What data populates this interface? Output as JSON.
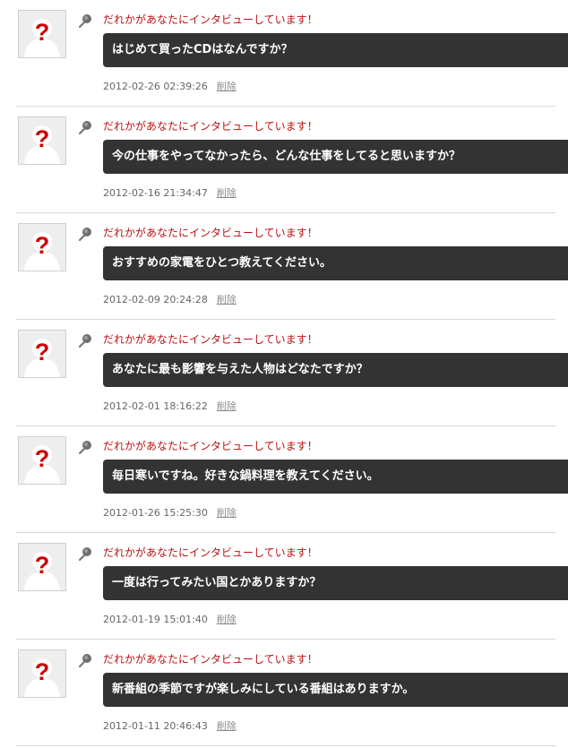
{
  "items": [
    {
      "heading": "だれかがあなたにインタビューしています！",
      "question": "はじめて買ったCDはなんですか？",
      "date": "2012-02-26 02:39:26",
      "delete_label": "削除"
    },
    {
      "heading": "だれかがあなたにインタビューしています！",
      "question": "今の仕事をやってなかったら、どんな仕事をしてると思いますか？",
      "date": "2012-02-16 21:34:47",
      "delete_label": "削除"
    },
    {
      "heading": "だれかがあなたにインタビューしています！",
      "question": "おすすめの家電をひとつ教えてください。",
      "date": "2012-02-09 20:24:28",
      "delete_label": "削除"
    },
    {
      "heading": "だれかがあなたにインタビューしています！",
      "question": "あなたに最も影響を与えた人物はどなたですか？",
      "date": "2012-02-01 18:16:22",
      "delete_label": "削除"
    },
    {
      "heading": "だれかがあなたにインタビューしています！",
      "question": "毎日寒いですね。好きな鍋料理を教えてください。",
      "date": "2012-01-26 15:25:30",
      "delete_label": "削除"
    },
    {
      "heading": "だれかがあなたにインタビューしています！",
      "question": "一度は行ってみたい国とかありますか？",
      "date": "2012-01-19 15:01:40",
      "delete_label": "削除"
    },
    {
      "heading": "だれかがあなたにインタビューしています！",
      "question": "新番組の季節ですが楽しみにしている番組はありますか。",
      "date": "2012-01-11 20:46:43",
      "delete_label": "削除"
    }
  ],
  "avatar_glyph": "?",
  "icons": {
    "avatar": "anonymous-avatar-icon",
    "mic": "microphone-icon"
  },
  "colors": {
    "heading": "#bb1111",
    "bubble": "#333333",
    "avatar_glyph": "#cc0000"
  }
}
